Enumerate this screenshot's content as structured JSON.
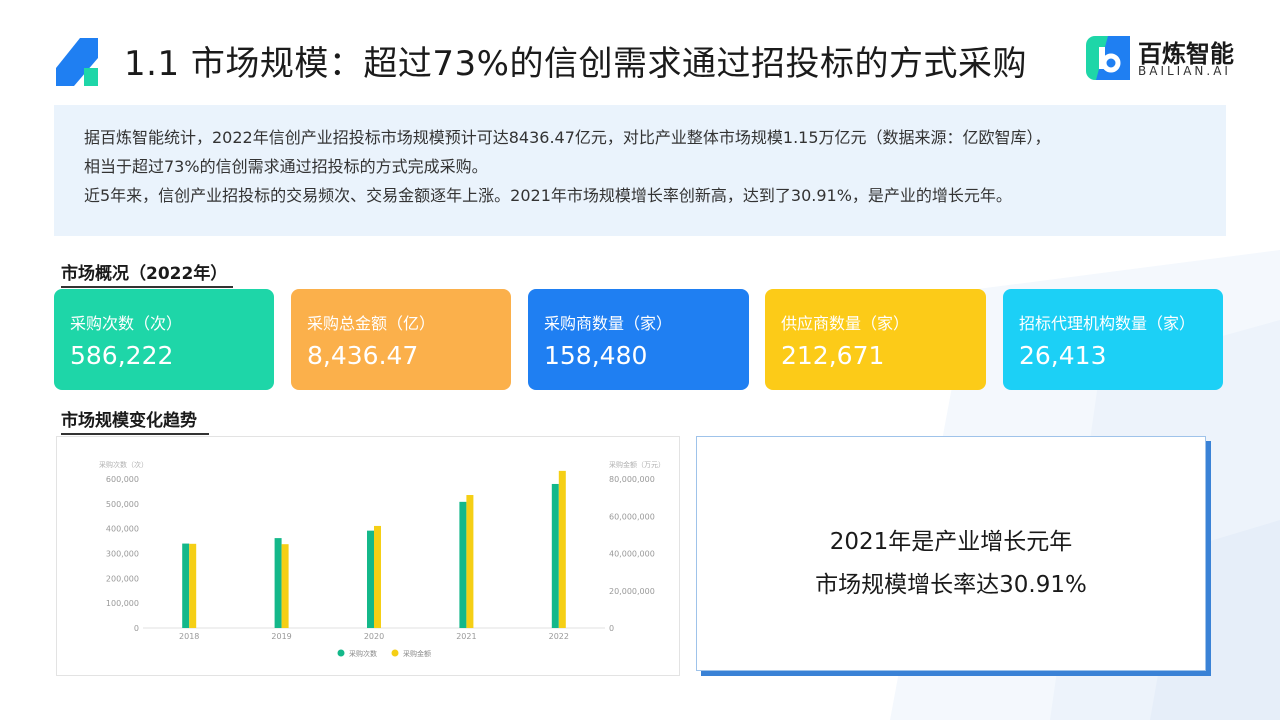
{
  "header": {
    "title": "1.1 市场规模：超过73%的信创需求通过招投标的方式采购",
    "brand_cn": "百炼智能",
    "brand_en": "BAILIAN.AI"
  },
  "intro": {
    "line1": "据百炼智能统计，2022年信创产业招投标市场规模预计可达8436.47亿元，对比产业整体市场规模1.15万亿元（数据来源：亿欧智库），",
    "line2": "相当于超过73%的信创需求通过招投标的方式完成采购。",
    "line3": "近5年来，信创产业招投标的交易频次、交易金额逐年上涨。2021年市场规模增长率创新高，达到了30.91%，是产业的增长元年。"
  },
  "overview": {
    "heading": "市场概况（2022年）",
    "cards": [
      {
        "label": "采购次数（次）",
        "value": "586,222",
        "color": "#1ed6a8"
      },
      {
        "label": "采购总金额（亿）",
        "value": "8,436.47",
        "color": "#fbb04b"
      },
      {
        "label": "采购商数量（家）",
        "value": "158,480",
        "color": "#1f7ff2"
      },
      {
        "label": "供应商数量（家）",
        "value": "212,671",
        "color": "#fccb18"
      },
      {
        "label": "招标代理机构数量（家）",
        "value": "26,413",
        "color": "#1cd0f6"
      }
    ]
  },
  "trend": {
    "heading": "市场规模变化趋势"
  },
  "highlight": {
    "line1": "2021年是产业增长元年",
    "line2": "市场规模增长率达30.91%"
  },
  "chart_data": {
    "type": "bar",
    "categories": [
      "2018",
      "2019",
      "2020",
      "2021",
      "2022"
    ],
    "series": [
      {
        "name": "采购次数",
        "axis": "left",
        "color": "#14b88a",
        "values": [
          340000,
          362000,
          392000,
          508000,
          580000
        ]
      },
      {
        "name": "采购金额",
        "axis": "right",
        "color": "#f5cf15",
        "values": [
          45200000,
          45000000,
          54800000,
          71400000,
          84364700
        ]
      }
    ],
    "ylabel_left": "采购次数（次）",
    "ylabel_right": "采购金额（万元）",
    "ylim_left": [
      0,
      600000
    ],
    "ylim_right": [
      0,
      80000000
    ],
    "yticks_left": [
      "0",
      "100,000",
      "200,000",
      "300,000",
      "400,000",
      "500,000",
      "600,000"
    ],
    "yticks_right": [
      "0",
      "20,000,000",
      "40,000,000",
      "60,000,000",
      "80,000,000"
    ],
    "legend_position": "bottom",
    "grid": false
  }
}
